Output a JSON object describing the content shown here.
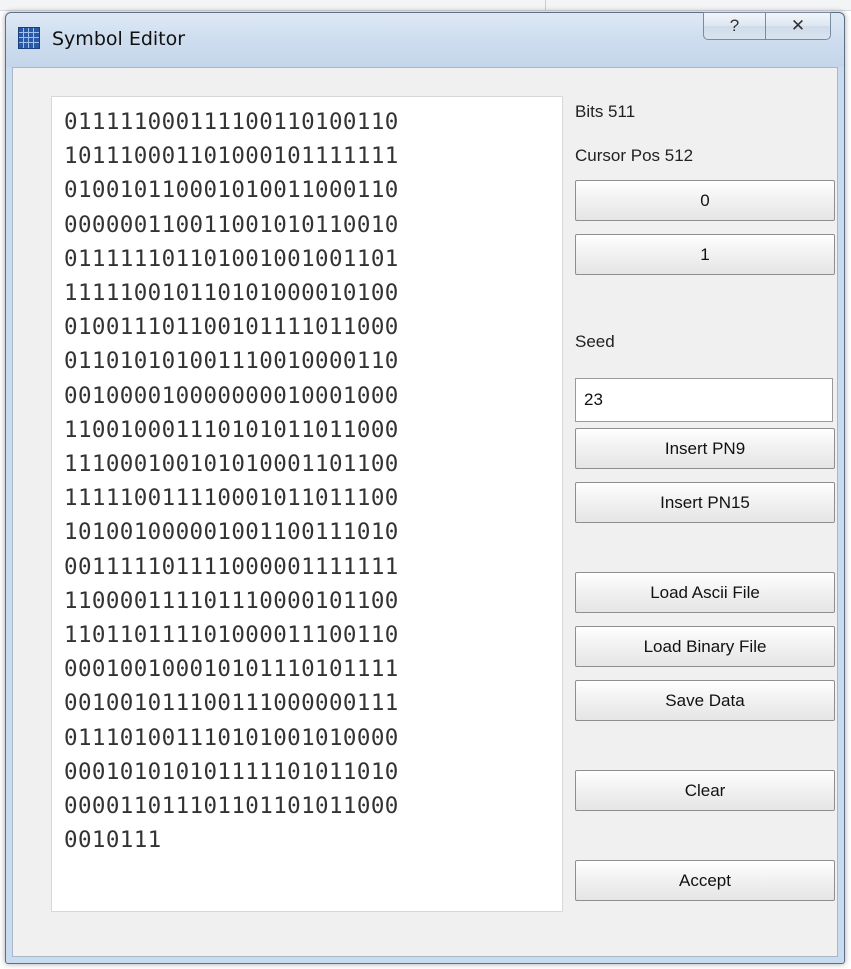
{
  "window": {
    "title": "Symbol Editor",
    "help_glyph": "?",
    "close_glyph": "✕"
  },
  "bits": {
    "lines": [
      "0111110001111001101001 10",
      "1011100011010001011111 11",
      "0100101100010100110001 10",
      "0000001100110010101100 10",
      "0111111011010010010011 01",
      "1111100101101010000101 00",
      "0100111011001011110110 00",
      "0110101010011100100001 10",
      "0010000100000000100010 00",
      "1100100011101010110110 00",
      "1110001001010100011011 00",
      "1111100111100010110111 00",
      "1010010000010011001110 10",
      "0011111011110000011111 11",
      "1100001111011100001011 00",
      "1101101111010000111001 10",
      "0001001000101011101011 11",
      "0010010111001110000001 11",
      "0111010011101010010100 00",
      "0001010101011111010110 10",
      "0000110111011011010110 00",
      "0010111"
    ]
  },
  "status": {
    "bits_label": "Bits 511",
    "cursor_label": "Cursor Pos 512"
  },
  "buttons": {
    "zero": "0",
    "one": "1",
    "insert_pn9": "Insert PN9",
    "insert_pn15": "Insert PN15",
    "load_ascii": "Load Ascii File",
    "load_binary": "Load Binary File",
    "save_data": "Save Data",
    "clear": "Clear",
    "accept": "Accept"
  },
  "seed": {
    "label": "Seed",
    "value": "23"
  }
}
